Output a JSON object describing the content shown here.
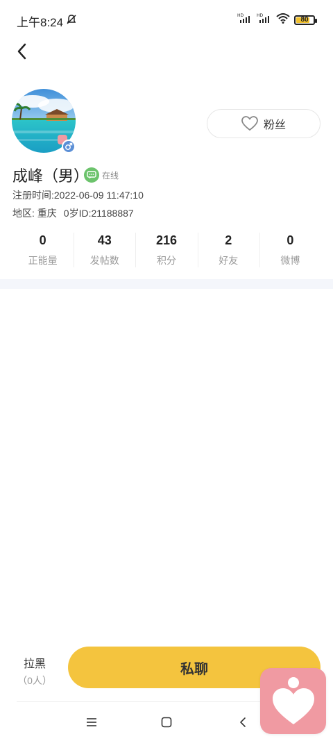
{
  "status_bar": {
    "time": "上午8:24",
    "battery": "80",
    "battery_level": 0.8
  },
  "profile": {
    "name": "成峰（男）",
    "online_status": "在线",
    "registered": "注册时间:2022-06-09 11:47:10",
    "region": "地区: 重庆",
    "age_id": "0岁ID:21188887",
    "fans_label": "粉丝"
  },
  "stats": [
    {
      "value": "0",
      "label": "正能量"
    },
    {
      "value": "43",
      "label": "发帖数"
    },
    {
      "value": "216",
      "label": "积分"
    },
    {
      "value": "2",
      "label": "好友"
    },
    {
      "value": "0",
      "label": "微博"
    }
  ],
  "actions": {
    "block_label": "拉黑",
    "block_count": "（0人）",
    "chat_label": "私聊"
  },
  "colors": {
    "accent": "#f4c43e",
    "online": "#6cc36c",
    "gender_male": "#5b8fd6",
    "float_pink": "#f09aa2"
  },
  "icons": {
    "back": "chevron-left-icon",
    "fans": "heart-outline-icon",
    "online": "chat-bubble-icon",
    "gender": "male-icon",
    "float": "heart-person-icon"
  }
}
